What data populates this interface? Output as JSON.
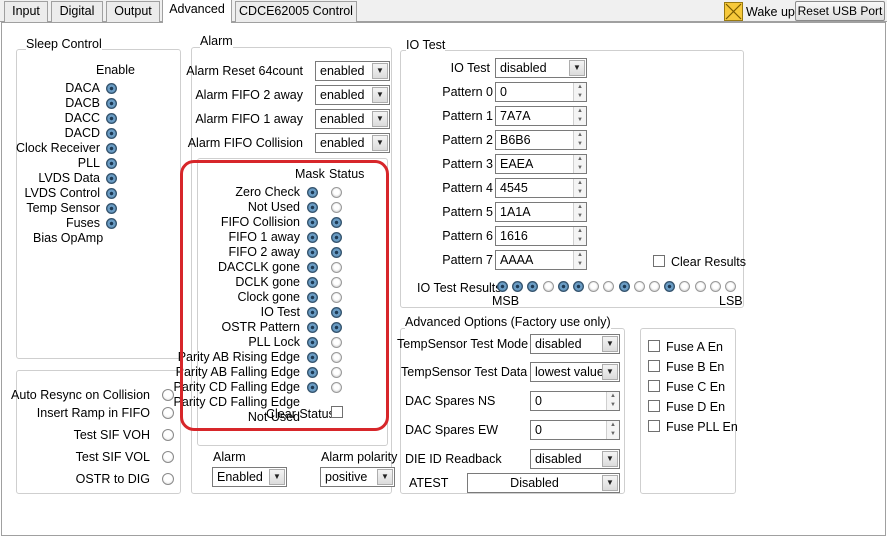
{
  "tabs": [
    "Input",
    "Digital",
    "Output",
    "Advanced",
    "CDCE62005 Control"
  ],
  "top_right": {
    "wake_up_label": "Wake up",
    "reset_usb_label": "Reset USB Port",
    "wake_up_color": "#f7c93b"
  },
  "sleep_control": {
    "title": "Sleep Control",
    "column_header": "Enable",
    "items": [
      "DACA",
      "DACB",
      "DACC",
      "DACD",
      "Clock Receiver",
      "PLL",
      "LVDS Data",
      "LVDS Control",
      "Temp Sensor",
      "Fuses",
      "Bias OpAmp"
    ]
  },
  "alarm": {
    "title": "Alarm",
    "settings": [
      {
        "label": "Alarm Reset 64count",
        "value": "enabled"
      },
      {
        "label": "Alarm FIFO 2 away",
        "value": "enabled"
      },
      {
        "label": "Alarm FIFO 1 away",
        "value": "enabled"
      },
      {
        "label": "Alarm FIFO Collision",
        "value": "enabled"
      }
    ],
    "mask_header": "Mask",
    "status_header": "Status",
    "items": [
      "Zero Check",
      "Not Used",
      "FIFO Collision",
      "FIFO 1 away",
      "FIFO 2 away",
      "DACCLK gone",
      "DCLK gone",
      "Clock gone",
      "IO Test",
      "OSTR Pattern",
      "PLL Lock",
      "Parity AB Rising Edge",
      "Parity AB Falling Edge",
      "Parity CD Falling Edge",
      "Parity CD Falling Edge",
      "Not Used"
    ],
    "status_on": [
      false,
      false,
      true,
      true,
      true,
      false,
      false,
      false,
      true,
      true,
      false,
      false,
      false,
      false
    ],
    "clear_status_label": "Clear Status",
    "alarm_label": "Alarm",
    "alarm_value": "Enabled",
    "polarity_label": "Alarm polarity",
    "polarity_value": "positive",
    "highlight_color": "#d7262a"
  },
  "io_test": {
    "title": "IO Test",
    "io_test_label": "IO Test",
    "io_test_value": "disabled",
    "patterns": [
      {
        "label": "Pattern 0",
        "value": "0"
      },
      {
        "label": "Pattern 1",
        "value": "7A7A"
      },
      {
        "label": "Pattern 2",
        "value": "B6B6"
      },
      {
        "label": "Pattern 3",
        "value": "EAEA"
      },
      {
        "label": "Pattern 4",
        "value": "4545"
      },
      {
        "label": "Pattern 5",
        "value": "1A1A"
      },
      {
        "label": "Pattern 6",
        "value": "1616"
      },
      {
        "label": "Pattern 7",
        "value": "AAAA"
      }
    ],
    "clear_results_label": "Clear Results",
    "results_label": "IO Test Results",
    "results_bits": [
      true,
      true,
      true,
      false,
      true,
      true,
      false,
      false,
      true,
      false,
      false,
      true,
      false,
      false,
      false,
      false
    ],
    "msb_label": "MSB",
    "lsb_label": "LSB"
  },
  "auto_resync": {
    "items": [
      "Auto Resync on Collision",
      "Insert Ramp in FIFO",
      "Test SIF VOH",
      "Test SIF VOL",
      "OSTR to DIG"
    ]
  },
  "advanced_options": {
    "title": "Advanced Options (Factory use only)",
    "tempsensor_mode_label": "TempSensor Test Mode",
    "tempsensor_mode_value": "disabled",
    "tempsensor_data_label": "TempSensor Test Data",
    "tempsensor_data_value": "lowest value",
    "dac_spares_ns_label": "DAC Spares NS",
    "dac_spares_ns_value": "0",
    "dac_spares_ew_label": "DAC Spares EW",
    "dac_spares_ew_value": "0",
    "die_id_label": "DIE ID Readback",
    "die_id_value": "disabled",
    "atest_label": "ATEST",
    "atest_value": "Disabled"
  },
  "fuses": {
    "items": [
      "Fuse A En",
      "Fuse B En",
      "Fuse C En",
      "Fuse D En",
      "Fuse PLL En"
    ]
  }
}
